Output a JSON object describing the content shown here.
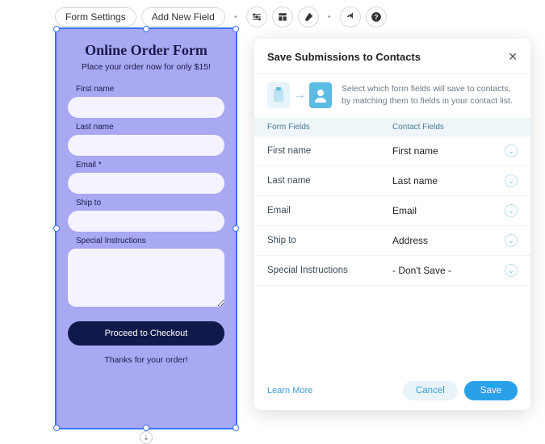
{
  "toolbar": {
    "form_settings": "Form Settings",
    "add_new_field": "Add New Field"
  },
  "form": {
    "title": "Online Order Form",
    "subtitle": "Place your order now for only $15!",
    "fields": {
      "first_name": "First name",
      "last_name": "Last name",
      "email": "Email *",
      "ship_to": "Ship to",
      "special": "Special Instructions"
    },
    "checkout": "Proceed to Checkout",
    "thanks": "Thanks for your order!"
  },
  "modal": {
    "title": "Save Submissions to Contacts",
    "info": "Select which form fields will save to contacts, by matching them to fields in your contact list.",
    "head_form": "Form Fields",
    "head_contact": "Contact Fields",
    "rows": [
      {
        "form": "First name",
        "contact": "First name"
      },
      {
        "form": "Last name",
        "contact": "Last name"
      },
      {
        "form": "Email",
        "contact": "Email"
      },
      {
        "form": "Ship to",
        "contact": "Address"
      },
      {
        "form": "Special Instructions",
        "contact": "- Don't Save -"
      }
    ],
    "learn_more": "Learn More",
    "cancel": "Cancel",
    "save": "Save"
  }
}
